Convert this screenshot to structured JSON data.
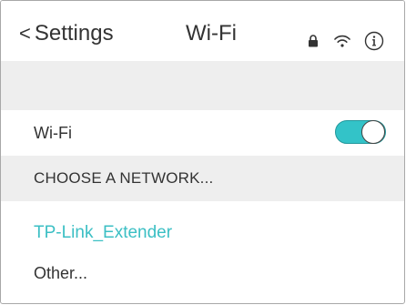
{
  "nav": {
    "back_chevron": "<",
    "back_label": "Settings",
    "title": "Wi-Fi"
  },
  "wifi": {
    "label": "Wi-Fi",
    "enabled": true
  },
  "section": {
    "choose_network": "CHOOSE A NETWORK..."
  },
  "networks": [
    {
      "name": "TP-Link_Extender",
      "secured": true,
      "icons": [
        "lock-icon",
        "wifi-signal-icon",
        "info-icon"
      ]
    }
  ],
  "other": {
    "label": "Other..."
  },
  "colors": {
    "accent": "#3bbfc4",
    "toggle_on": "#33c3c8",
    "band": "#eeeeee",
    "text": "#333333"
  }
}
